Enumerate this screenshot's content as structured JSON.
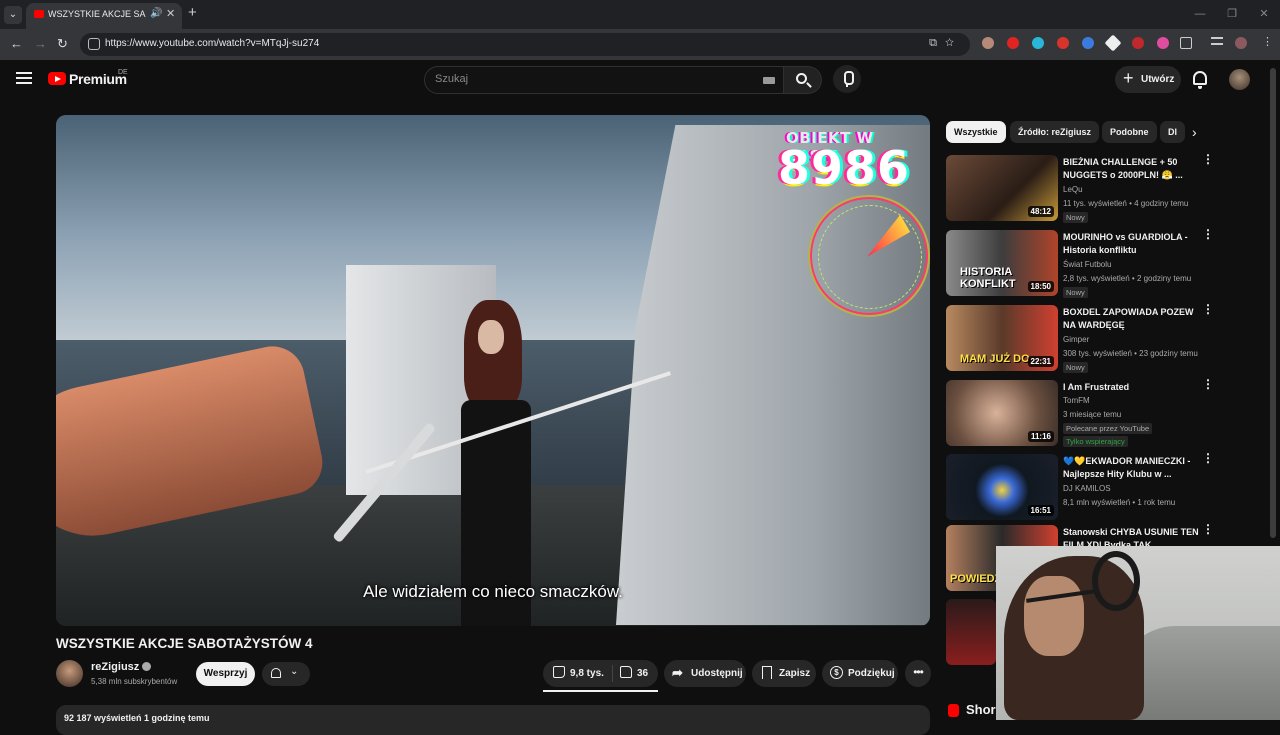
{
  "browser": {
    "tab_title": "WSZYSTKIE AKCJE SABOTAŻ",
    "url": "https://www.youtube.com/watch?v=MTqJj-su274"
  },
  "header": {
    "logo_text": "Premium",
    "logo_sup": "DE",
    "search_placeholder": "Szukaj",
    "create_label": "Utwórz"
  },
  "video": {
    "overlay_title": "OBIEKT W ZASIĘ",
    "overlay_number": "8986",
    "subtitle": "Ale widziałem co nieco smaczków.",
    "title": "WSZYSTKIE AKCJE SABOTAŻYSTÓW 4",
    "channel": "reZigiusz",
    "subscribers": "5,38 mln subskrybentów",
    "support_label": "Wesprzyj",
    "likes": "9,8 tys.",
    "dislikes": "36",
    "share_label": "Udostępnij",
    "save_label": "Zapisz",
    "thanks_label": "Podziękuj",
    "views_line": "92 187 wyświetleń  1 godzinę temu"
  },
  "chips": [
    "Wszystkie",
    "Źródło: reZigiusz",
    "Podobne",
    "Dl"
  ],
  "recommendations": [
    {
      "title": "BIEŻNIA CHALLENGE + 50 NUGGETS o 2000PLN! 😤 ...",
      "channel": "LeQu",
      "meta": "11 tys. wyświetleń • 4 godziny temu",
      "badge": "Nowy",
      "duration": "48:12",
      "thumb_text": ""
    },
    {
      "title": "MOURINHO vs GUARDIOLA - Historia konfliktu",
      "channel": "Świat Futbolu",
      "meta": "2,8 tys. wyświetleń • 2 godziny temu",
      "badge": "Nowy",
      "duration": "18:50",
      "thumb_text": "HISTORIA KONFLIKT"
    },
    {
      "title": "BOXDEL ZAPOWIADA POZEW NA WARDĘGĘ",
      "channel": "Gimper",
      "meta": "308 tys. wyświetleń • 23 godziny temu",
      "badge": "Nowy",
      "duration": "22:31",
      "thumb_text": "MAM JUŻ DO"
    },
    {
      "title": "I Am Frustrated",
      "channel": "TomFM",
      "meta": "3 miesiące temu",
      "badge": "Polecane przez YouTube",
      "badge2": "Tylko wspierający",
      "duration": "11:16",
      "thumb_text": ""
    },
    {
      "title": "💙💛EKWADOR MANIECZKI - Najlepsze Hity Klubu w ...",
      "channel": "DJ KAMILOS",
      "meta": "8,1 mln wyświetleń • 1 rok temu",
      "badge": "",
      "duration": "16:51",
      "thumb_text": ""
    },
    {
      "title": "Stanowski CHYBA USUNIE TEN FILM XD| Bydka TAK",
      "channel": "",
      "meta": "",
      "badge": "",
      "duration": "",
      "thumb_text": "POWIEDZIA"
    }
  ],
  "shorts_label": "Shor",
  "colors": {
    "brand": "#ff0000",
    "bg": "#0f0f0f",
    "chip_active": "#f1f1f1"
  }
}
